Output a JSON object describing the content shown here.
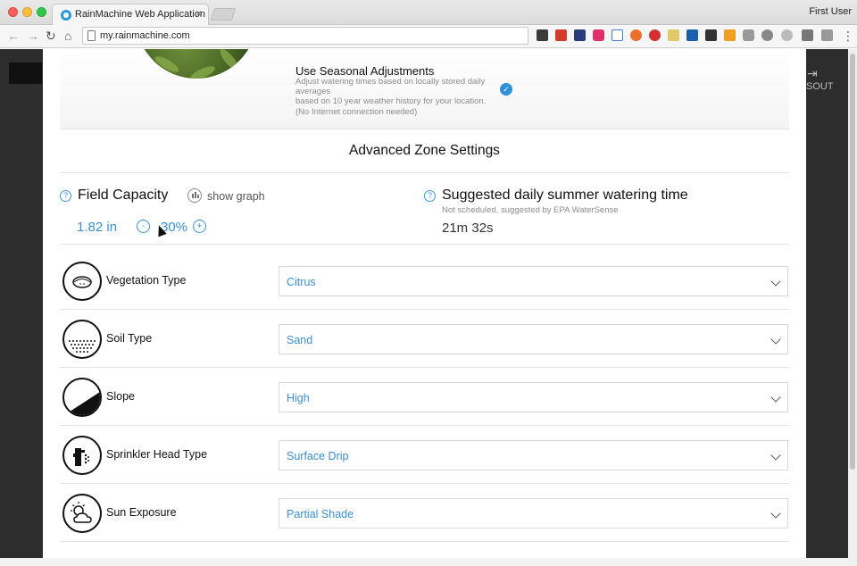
{
  "browser": {
    "tab_title": "RainMachine Web Application",
    "tab_close": "×",
    "profile": "First User",
    "url": "my.rainmachine.com",
    "back": "←",
    "forward": "→",
    "reload": "↻",
    "home": "⌂"
  },
  "background": {
    "logout_icon": "⇥",
    "logout_text": "SOUT"
  },
  "seasonal": {
    "title": "Use Seasonal Adjustments",
    "description_lines": [
      "Adjust watering times based on locally stored daily",
      "averages",
      "based on 10 year weather history for your location.",
      "(No Internet connection needed)"
    ],
    "checked": true,
    "check_glyph": "✓"
  },
  "advanced": {
    "title": "Advanced Zone Settings",
    "help_glyph": "?",
    "field_capacity": {
      "label": "Field Capacity",
      "show_graph": "show graph",
      "value": "1.82 in",
      "decrement": "-",
      "percent": "30%",
      "increment": "+"
    },
    "suggested": {
      "label": "Suggested daily summer watering time",
      "subtitle": "Not scheduled, suggested by EPA WaterSense",
      "value": "21m 32s"
    }
  },
  "settings": [
    {
      "label": "Vegetation Type",
      "value": "Citrus",
      "icon": "vegetation-icon"
    },
    {
      "label": "Soil Type",
      "value": "Sand",
      "icon": "soil-icon"
    },
    {
      "label": "Slope",
      "value": "High",
      "icon": "slope-icon"
    },
    {
      "label": "Sprinkler Head Type",
      "value": "Surface Drip",
      "icon": "sprinkler-icon"
    },
    {
      "label": "Sun Exposure",
      "value": "Partial Shade",
      "icon": "sun-exposure-icon"
    }
  ]
}
